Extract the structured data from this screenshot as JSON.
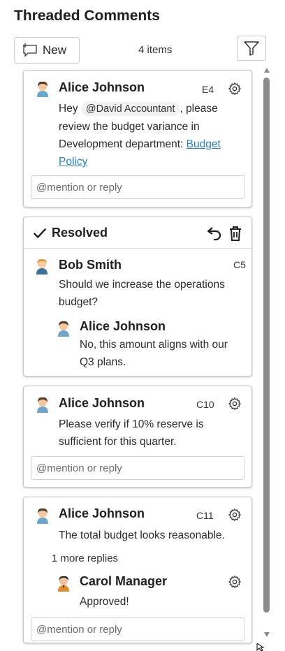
{
  "header": {
    "title": "Threaded Comments",
    "new_label": "New",
    "items_count": "4 items"
  },
  "threads": [
    {
      "author": "Alice Johnson",
      "cell": "E4",
      "text_before": "Hey ",
      "mention": "@David Accountant",
      "text_after": ", please review the budget variance in Development department: ",
      "link_text": "Budget Policy",
      "reply_placeholder": "@mention or reply"
    },
    {
      "status": "Resolved",
      "author": "Bob Smith",
      "cell": "C5",
      "text": "Should we increase the operations budget?",
      "reply": {
        "author": "Alice Johnson",
        "text": "No, this amount aligns with our Q3 plans."
      }
    },
    {
      "author": "Alice Johnson",
      "cell": "C10",
      "text": "Please verify if 10% reserve is sufficient for this quarter.",
      "reply_placeholder": "@mention or reply"
    },
    {
      "author": "Alice Johnson",
      "cell": "C11",
      "text": "The total budget looks reasonable.",
      "more_replies": "1 more replies",
      "reply": {
        "author": "Carol Manager",
        "text": "Approved!"
      },
      "reply_placeholder": "@mention or reply"
    }
  ]
}
